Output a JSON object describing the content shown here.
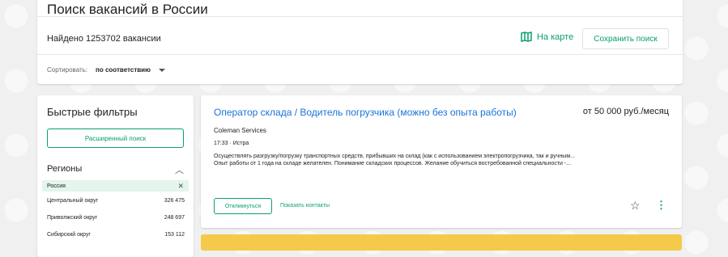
{
  "header": {
    "title": "Поиск вакансий в России",
    "found": "Найдено 1253702 вакансии",
    "map_link": "На карте",
    "save_search": "Сохранить поиск",
    "sort_label": "Сортировать:",
    "sort_value": "по соответствию"
  },
  "filters": {
    "title": "Быстрые фильтры",
    "advanced": "Расширенный поиск",
    "regions_title": "Регионы",
    "selected_region": "Россия",
    "regions": [
      {
        "name": "Центральный округ",
        "count": "326 475"
      },
      {
        "name": "Приволжский округ",
        "count": "248 697"
      },
      {
        "name": "Сибирский округ",
        "count": "153 112"
      }
    ]
  },
  "vacancy": {
    "title": "Оператор склада / Водитель погрузчика (можно без опыта работы)",
    "salary": "от 50 000 руб./месяц",
    "company": "Coleman Services",
    "meta": "17:33 · Истра",
    "desc_1": "Осуществлять разгрузку/погрузку транспортных средств, прибывших на склад (как с использованием электропогрузчика, так и ручным...",
    "desc_2": "Опыт работы от 1 года на складе желателен. Понимание складских процессов. Желание обучиться востребованной специальности -...",
    "respond": "Откликнуться",
    "contacts": "Показать контакты"
  },
  "icons": {
    "map": "map-icon",
    "star": "star-icon",
    "kebab": "more-vertical-icon",
    "close": "close-icon",
    "chevron": "chevron-up-icon"
  },
  "colors": {
    "accent": "#0aa06e",
    "link": "#1a73d9",
    "banner": "#f5c94a"
  }
}
